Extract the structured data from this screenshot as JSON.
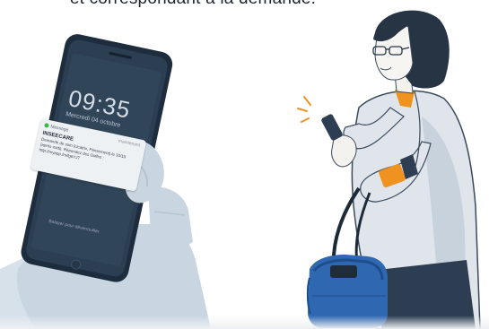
{
  "headline": "et correspondant à la demande.",
  "phone": {
    "time": "09:35",
    "date": "Mercredi 04 octobre",
    "notification": {
      "app": "Message",
      "time": "maintenant",
      "title": "INSEECARE",
      "body": "Demande de soin (cicatrix, Pansement) le 10/10 (après-midi). Répondez des Golfes : http://myapp.fm/fg6YJ7"
    },
    "unlock_hint": "Balayer pour déverrouiller"
  },
  "colors": {
    "phone_body": "#233446",
    "screen": "#2c3e52",
    "hand": "#c9d6e2",
    "coat": "#dfe5ea",
    "hair": "#273444",
    "accent_orange": "#f0921f",
    "bag": "#2f67b1"
  },
  "icons": [
    "message-icon",
    "sparkle-lines-icon"
  ]
}
